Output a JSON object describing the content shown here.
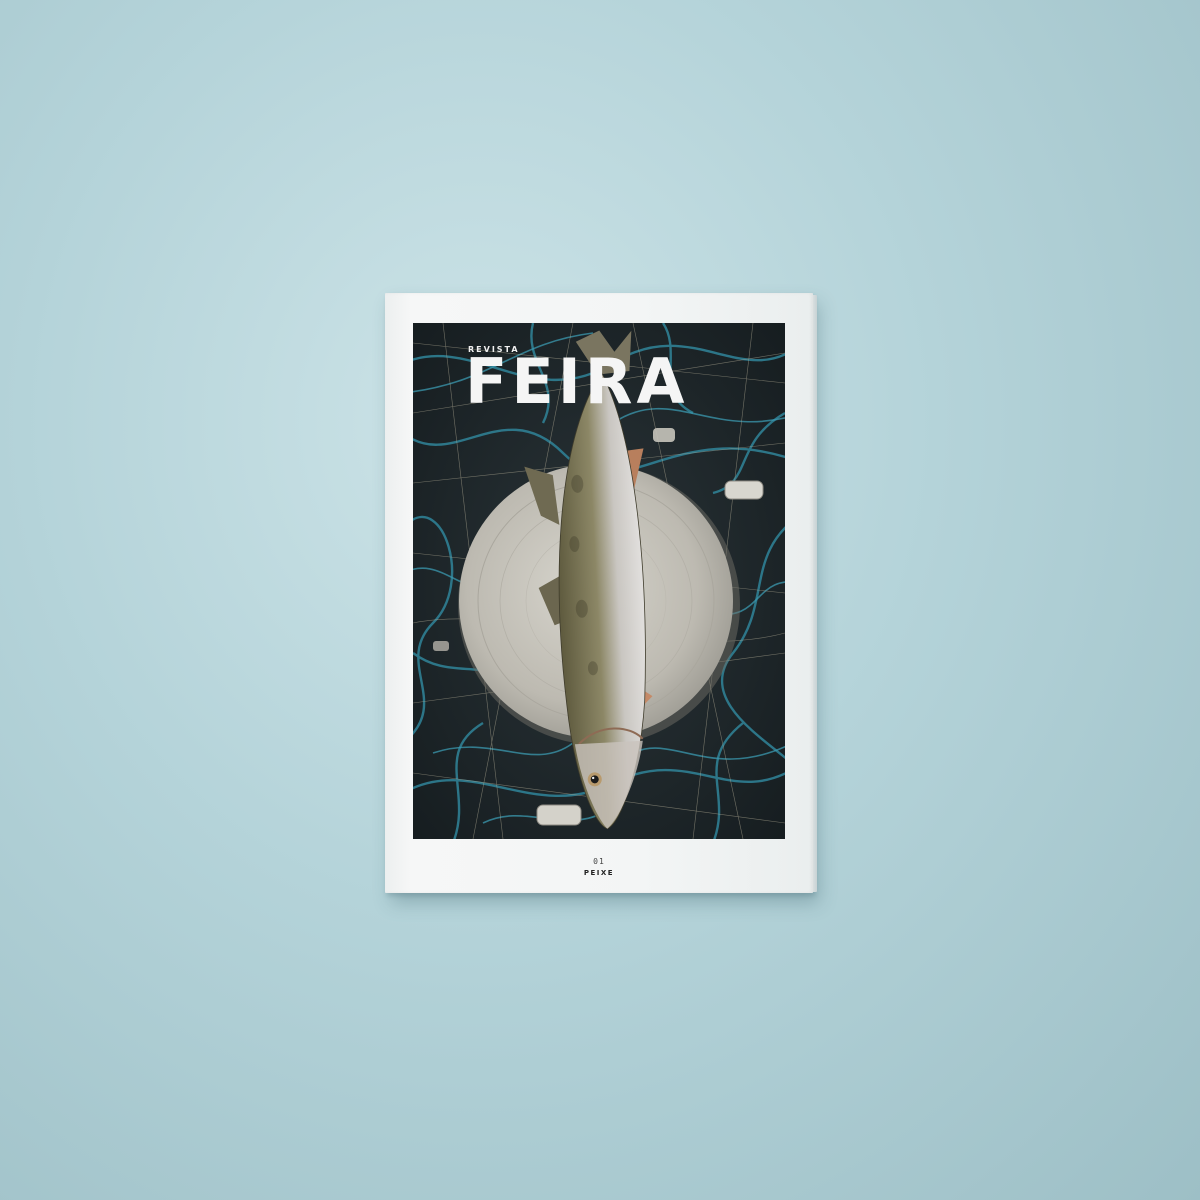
{
  "magazine": {
    "masthead_kicker": "REVISTA",
    "masthead_title": "FEIRA",
    "issue_number": "01",
    "issue_theme": "PEIXE"
  },
  "cover_photo": {
    "subject": "fish-on-plate-icon"
  },
  "colors": {
    "background": "#b4d3d9",
    "cover_paper": "#f4f6f6",
    "photo_dark": "#1f272b",
    "net_blue": "#2f7f93",
    "masthead_text": "#f5f5f5"
  }
}
